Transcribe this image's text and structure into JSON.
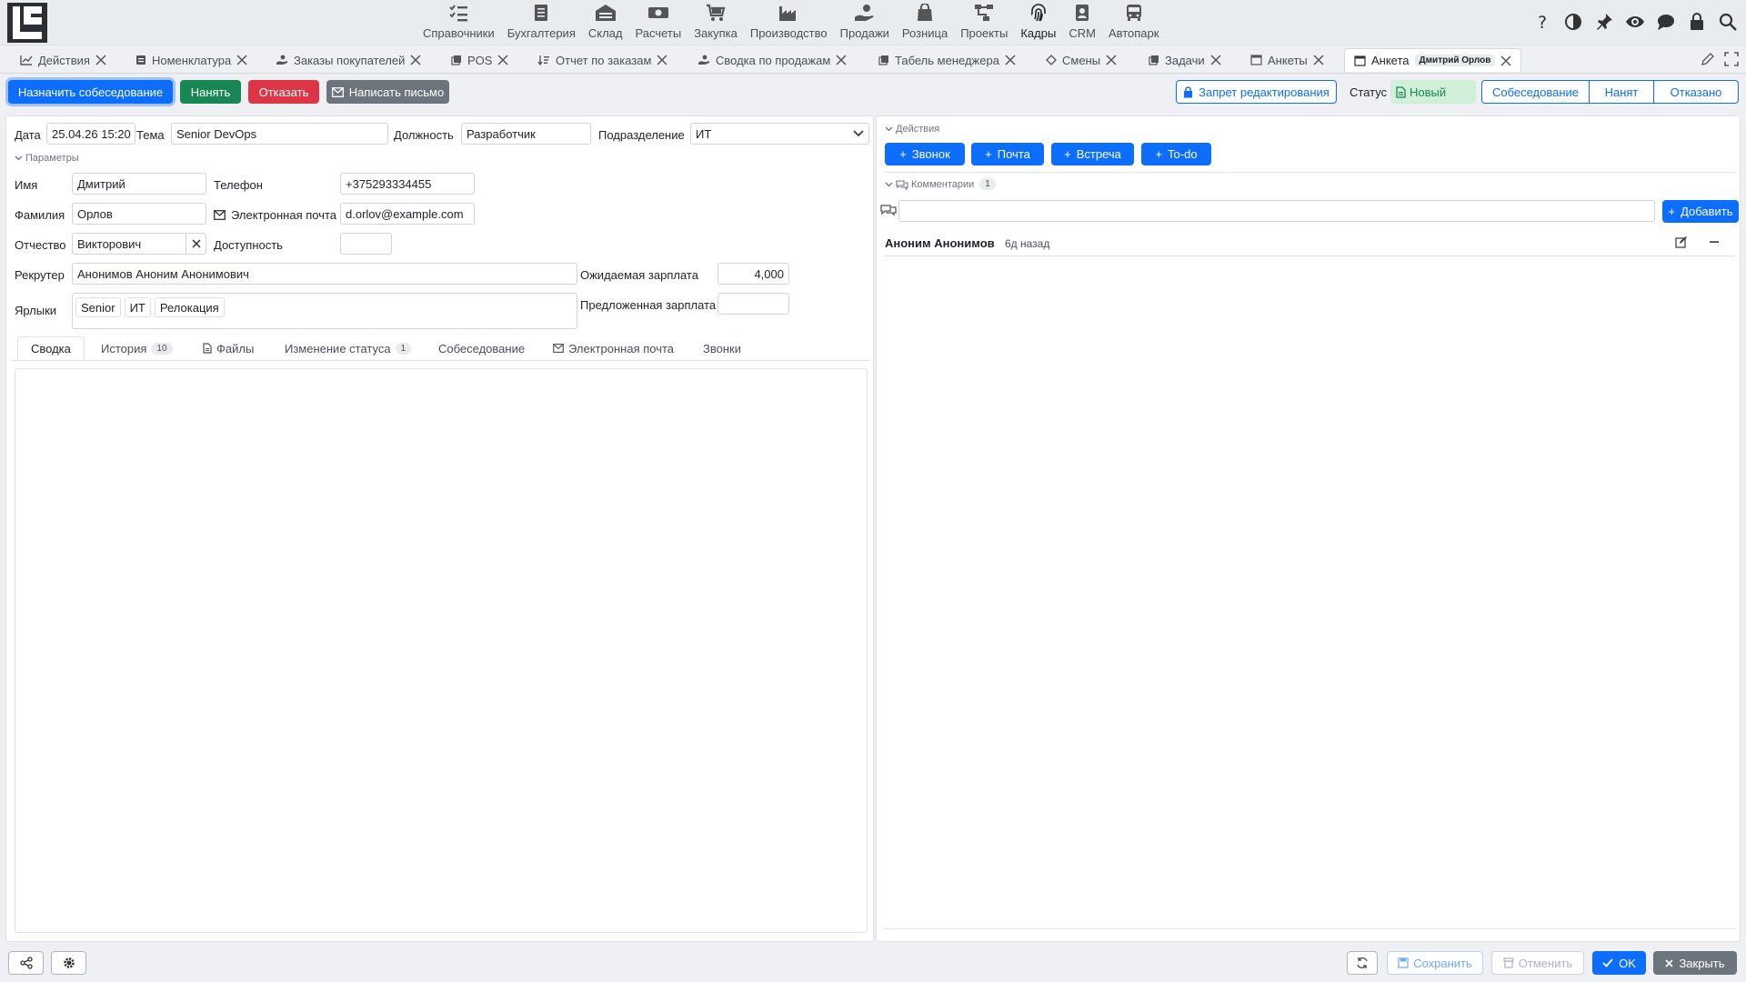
{
  "brand": {
    "accent": "#0d6efd",
    "success": "#198754",
    "danger": "#dc3545",
    "secondary": "#6c757d"
  },
  "nav": {
    "modules": [
      {
        "label": "Справочники",
        "icon": "checklist-icon"
      },
      {
        "label": "Бухгалтерия",
        "icon": "ledger-icon"
      },
      {
        "label": "Склад",
        "icon": "warehouse-icon"
      },
      {
        "label": "Расчеты",
        "icon": "money-icon"
      },
      {
        "label": "Закупка",
        "icon": "cart-icon"
      },
      {
        "label": "Производство",
        "icon": "factory-icon"
      },
      {
        "label": "Продажи",
        "icon": "hand-coin-icon"
      },
      {
        "label": "Розница",
        "icon": "shopping-bag-icon"
      },
      {
        "label": "Проекты",
        "icon": "diagram-icon"
      },
      {
        "label": "Кадры",
        "icon": "fingerprint-icon"
      },
      {
        "label": "CRM",
        "icon": "contact-card-icon"
      },
      {
        "label": "Автопарк",
        "icon": "bus-icon"
      }
    ],
    "right_icons": [
      "help-icon",
      "contrast-icon",
      "pin-icon",
      "eye-icon",
      "chat-icon",
      "lock-icon",
      "search-icon"
    ]
  },
  "tabs": [
    {
      "label": "Действия",
      "icon": "chart-line-icon"
    },
    {
      "label": "Номенклатура",
      "icon": "catalog-icon"
    },
    {
      "label": "Заказы покупателей",
      "icon": "hand-icon"
    },
    {
      "label": "POS",
      "icon": "copy-icon"
    },
    {
      "label": "Отчет по заказам",
      "icon": "sort-icon"
    },
    {
      "label": "Сводка по продажам",
      "icon": "hand-icon"
    },
    {
      "label": "Табель менеджера",
      "icon": "copy-icon"
    },
    {
      "label": "Смены",
      "icon": "diamond-icon"
    },
    {
      "label": "Задачи",
      "icon": "copy-icon"
    },
    {
      "label": "Анкеты",
      "icon": "window-icon"
    },
    {
      "label": "Анкета",
      "icon": "window-icon",
      "chip": "Дмитрий Орлов"
    }
  ],
  "toolbar": {
    "schedule": "Назначить собеседование",
    "hire": "Нанять",
    "reject": "Отказать",
    "write": "Написать письмо",
    "edit_lock": "Запрет редактирования",
    "status_label": "Статус",
    "status_value": "Новый",
    "steps": [
      "Собеседование",
      "Нанят",
      "Отказано"
    ]
  },
  "form": {
    "date_label": "Дата",
    "date": "25.04.26 15:20",
    "topic_label": "Тема",
    "topic": "Senior DevOps",
    "position_label": "Должность",
    "position": "Разработчик",
    "dept_label": "Подразделение",
    "dept": "ИТ",
    "params_label": "Параметры",
    "first_name_label": "Имя",
    "first_name": "Дмитрий",
    "phone_label": "Телефон",
    "phone": "+375293334455",
    "last_name_label": "Фамилия",
    "last_name": "Орлов",
    "email_label": "Электронная почта",
    "email": "d.orlov@example.com",
    "patronymic_label": "Отчество",
    "patronymic": "Викторович",
    "availability_label": "Доступность",
    "availability": "",
    "recruiter_label": "Рекрутер",
    "recruiter": "Анонимов Аноним Анонимович",
    "expected_label": "Ожидаемая зарплата",
    "expected": "4,000",
    "offered_label": "Предложенная зарплата",
    "offered": "",
    "tags_label": "Ярлыки",
    "tags": [
      "Senior",
      "ИТ",
      "Релокация"
    ]
  },
  "form_tabs": [
    {
      "label": "Сводка"
    },
    {
      "label": "История",
      "count": "10"
    },
    {
      "label": "Файлы"
    },
    {
      "label": "Изменение статуса",
      "count": "1"
    },
    {
      "label": "Собеседование"
    },
    {
      "label": "Электронная почта"
    },
    {
      "label": "Звонки"
    }
  ],
  "actions": {
    "label": "Действия",
    "buttons": [
      "Звонок",
      "Почта",
      "Встреча",
      "To-do"
    ]
  },
  "comments": {
    "label": "Комментарии",
    "count": "1",
    "add": "Добавить",
    "input_value": "",
    "items": [
      {
        "author": "Аноним Анонимов",
        "time": "6д назад"
      }
    ]
  },
  "footer": {
    "save": "Сохранить",
    "cancel": "Отменить",
    "ok": "OK",
    "close": "Закрыть"
  }
}
